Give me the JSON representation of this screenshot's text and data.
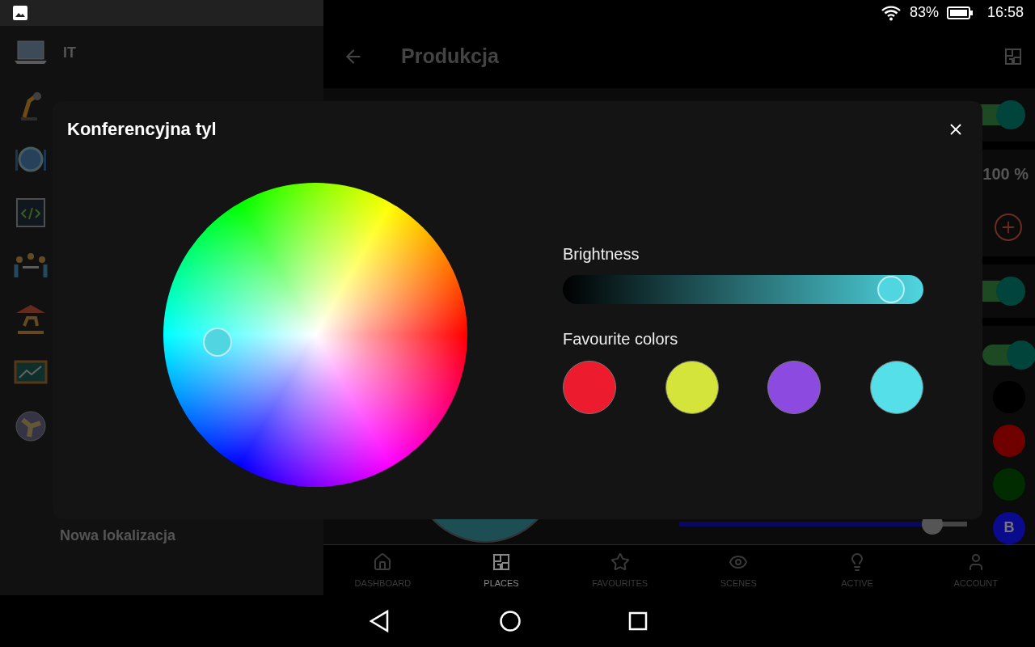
{
  "status_bar": {
    "battery": "83%",
    "time": "16:58"
  },
  "drawer": {
    "items": [
      {
        "label": "IT"
      }
    ],
    "footer": "Nowa lokalizacja"
  },
  "app_bar": {
    "title": "Produkcja"
  },
  "devices": [
    {
      "kind": "switch",
      "on": true
    },
    {
      "kind": "dimmer",
      "reading": "100 %"
    },
    {
      "kind": "switch",
      "on": true
    },
    {
      "kind": "rgbw",
      "on": true,
      "level": 0.88,
      "channels": [
        {
          "color": "#000000"
        },
        {
          "color": "#6e0000"
        },
        {
          "color": "#002c00"
        },
        {
          "label": "B",
          "color": "#0a0a8c"
        }
      ]
    }
  ],
  "bottom_nav": [
    {
      "label": "DASHBOARD",
      "selected": false
    },
    {
      "label": "PLACES",
      "selected": true
    },
    {
      "label": "FAVOURITES",
      "selected": false
    },
    {
      "label": "SCENES",
      "selected": false
    },
    {
      "label": "ACTIVE",
      "selected": false
    },
    {
      "label": "ACCOUNT",
      "selected": false
    }
  ],
  "dialog": {
    "title": "Konferencyjna tyl",
    "color": "#4fd6e0",
    "brightness_label": "Brightness",
    "brightness": {
      "level": 0.91
    },
    "favourites_label": "Favourite colors",
    "favourites": [
      {
        "color": "#ec1b2e"
      },
      {
        "color": "#d4e43a"
      },
      {
        "color": "#8c4ae0"
      },
      {
        "color": "#55dfe8"
      }
    ]
  }
}
